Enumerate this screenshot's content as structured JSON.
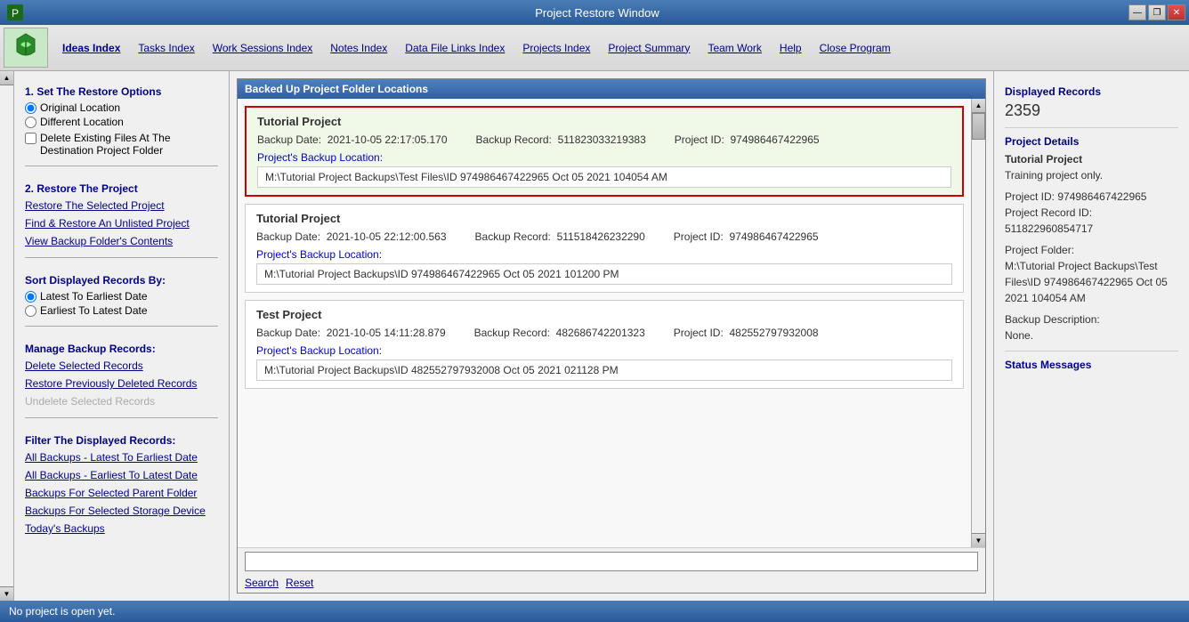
{
  "titlebar": {
    "title": "Project Restore Window",
    "minimize": "—",
    "restore": "❐",
    "close": "✕"
  },
  "menubar": {
    "items": [
      {
        "id": "ideas-index",
        "label": "Ideas Index",
        "active": false
      },
      {
        "id": "tasks-index",
        "label": "Tasks Index",
        "active": false
      },
      {
        "id": "work-sessions-index",
        "label": "Work Sessions Index",
        "active": false
      },
      {
        "id": "notes-index",
        "label": "Notes Index",
        "active": false
      },
      {
        "id": "data-file-links-index",
        "label": "Data File Links Index",
        "active": false
      },
      {
        "id": "projects-index",
        "label": "Projects Index",
        "active": false
      },
      {
        "id": "project-summary",
        "label": "Project Summary",
        "active": false
      },
      {
        "id": "team-work",
        "label": "Team Work",
        "active": false
      },
      {
        "id": "help",
        "label": "Help",
        "active": false
      },
      {
        "id": "close-program",
        "label": "Close Program",
        "active": false
      }
    ]
  },
  "sidebar": {
    "restore_options_title": "1. Set The Restore Options",
    "original_location_label": "Original Location",
    "different_location_label": "Different Location",
    "delete_files_label": "Delete Existing Files At The Destination Project Folder",
    "restore_project_title": "2. Restore The Project",
    "restore_selected_label": "Restore The Selected Project",
    "find_restore_label": "Find & Restore An Unlisted Project",
    "view_backup_label": "View Backup Folder's Contents",
    "sort_title": "Sort Displayed Records By:",
    "latest_first_label": "Latest To Earliest Date",
    "earliest_first_label": "Earliest To Latest Date",
    "manage_title": "Manage Backup Records:",
    "delete_selected_label": "Delete Selected Records",
    "restore_previously_label": "Restore Previously Deleted Records",
    "undelete_label": "Undelete Selected Records",
    "filter_title": "Filter The Displayed Records:",
    "all_backups_latest_label": "All Backups - Latest To Earliest Date",
    "all_backups_earliest_label": "All Backups - Earliest To Latest Date",
    "backups_parent_label": "Backups For Selected Parent Folder",
    "backups_storage_label": "Backups For Selected Storage Device",
    "todays_label": "Today's Backups"
  },
  "main": {
    "header": "Backed Up Project Folder Locations",
    "records": [
      {
        "id": 1,
        "title": "Tutorial Project",
        "backup_date": "2021-10-05  22:17:05.170",
        "backup_record": "511823033219383",
        "project_id": "974986467422965",
        "backup_location_label": "Project's Backup Location:",
        "backup_location": "M:\\Tutorial Project Backups\\Test Files\\ID 974986467422965 Oct 05 2021 104054 AM",
        "selected": true
      },
      {
        "id": 2,
        "title": "Tutorial Project",
        "backup_date": "2021-10-05  22:12:00.563",
        "backup_record": "511518426232290",
        "project_id": "974986467422965",
        "backup_location_label": "Project's Backup Location:",
        "backup_location": "M:\\Tutorial Project Backups\\ID 974986467422965 Oct 05 2021 101200 PM",
        "selected": false
      },
      {
        "id": 3,
        "title": "Test Project",
        "backup_date": "2021-10-05  14:11:28.879",
        "backup_record": "482686742201323",
        "project_id": "482552797932008",
        "backup_location_label": "Project's Backup Location:",
        "backup_location": "M:\\Tutorial Project Backups\\ID 482552797932008 Oct 05 2021 021128 PM",
        "selected": false
      }
    ],
    "search_placeholder": "",
    "search_label": "Search",
    "reset_label": "Reset"
  },
  "right_panel": {
    "displayed_records_title": "Displayed Records",
    "displayed_records_value": "2359",
    "project_details_title": "Project Details",
    "project_name": "Tutorial Project",
    "project_desc": "Training project only.",
    "project_id_label": "Project ID:",
    "project_id_value": "974986467422965",
    "project_record_id_label": "Project Record ID:",
    "project_record_id_value": "511822960854717",
    "project_folder_label": "Project Folder:",
    "project_folder_value": "M:\\Tutorial Project Backups\\Test Files\\ID 974986467422965 Oct 05 2021 104054 AM",
    "backup_desc_label": "Backup Description:",
    "backup_desc_value": "None.",
    "status_messages_title": "Status Messages"
  },
  "statusbar": {
    "message": "No project is open yet."
  }
}
